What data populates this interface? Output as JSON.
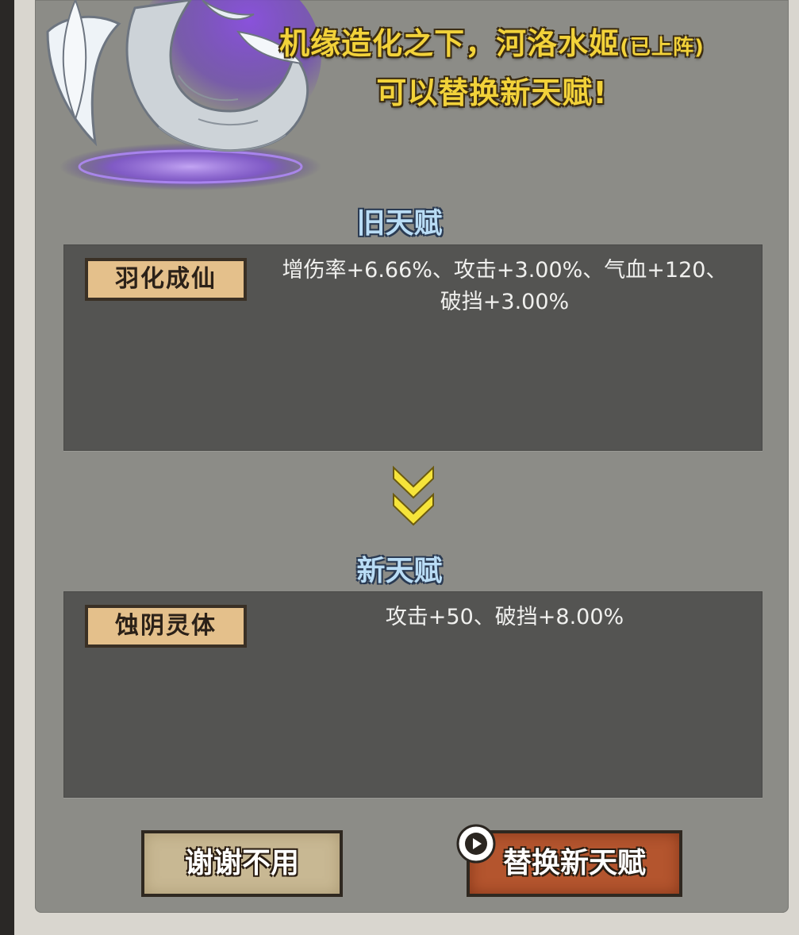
{
  "header": {
    "line1_main": "机缘造化之下，河洛水姬",
    "line1_note": "(已上阵)",
    "line2": "可以替换新天赋!"
  },
  "old_talent": {
    "title": "旧天赋",
    "name": "羽化成仙",
    "desc_line1": "增伤率+6.66%、攻击+3.00%、气血+120、",
    "desc_line2": "破挡+3.00%"
  },
  "new_talent": {
    "title": "新天赋",
    "name": "蚀阴灵体",
    "desc": "攻击+50、破挡+8.00%"
  },
  "buttons": {
    "decline_label": "谢谢不用",
    "replace_label": "替换新天赋"
  },
  "icons": {
    "arrow": "double-chevron-down-icon",
    "play": "play-icon",
    "character": "dragon-portrait"
  },
  "colors": {
    "headline": "#f2d23a",
    "section_title": "#b9dcf5",
    "tag_bg": "#e4c08b",
    "replace_button": "#b4552e",
    "decline_button": "#c8b893"
  }
}
